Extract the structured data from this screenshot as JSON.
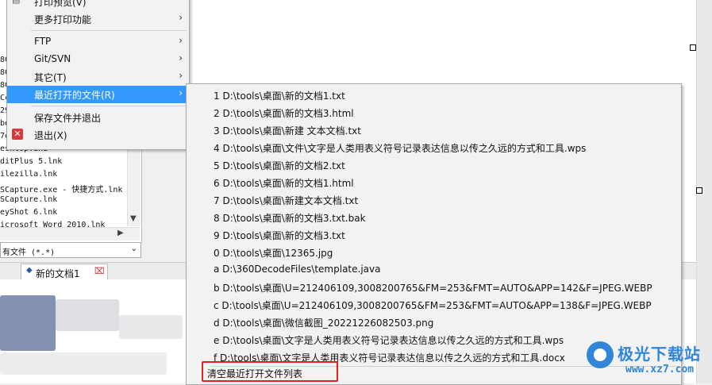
{
  "file_panel": {
    "rows": [
      "8C",
      "8C",
      "8C",
      "Cc",
      "29",
      "be",
      "7e",
      "esktop.ini",
      "ditPlus 5.lnk",
      "ilezilla.lnk",
      "SCapture.exe - 快捷方式.lnk",
      "SCapture.lnk",
      "eyShot 6.lnk",
      "icrosoft Word 2010.lnk"
    ],
    "filter_label": "有文件 (*.*)",
    "filter_dropdown": "⌄"
  },
  "tabs": [
    {
      "label": "新的文档1",
      "icon": "document-icon",
      "close": "⌧"
    }
  ],
  "menu": {
    "items": [
      {
        "label": "打印预览(V)",
        "submenu": false
      },
      {
        "label": "更多打印功能",
        "submenu": true
      },
      {
        "label": "FTP",
        "submenu": true
      },
      {
        "label": "Git/SVN",
        "submenu": true
      },
      {
        "label": "其它(T)",
        "submenu": true
      },
      {
        "label": "最近打开的文件(R)",
        "submenu": true,
        "highlighted": true
      },
      {
        "label": "保存文件并退出",
        "submenu": false
      },
      {
        "label": "退出(X)",
        "submenu": false
      }
    ],
    "submenu_arrow": "›"
  },
  "recent_files": {
    "items": [
      "1 D:\\tools\\桌面\\新的文档1.txt",
      "2 D:\\tools\\桌面\\新的文档3.html",
      "3 D:\\tools\\桌面\\新建 文本文档.txt",
      "4 D:\\tools\\桌面\\文件\\文字是人类用表义符号记录表达信息以传之久远的方式和工具.wps",
      "5 D:\\tools\\桌面\\新的文档2.txt",
      "6 D:\\tools\\桌面\\新的文档1.html",
      "7 D:\\tools\\桌面\\新建文本文档.txt",
      "8 D:\\tools\\桌面\\新的文档3.txt.bak",
      "9 D:\\tools\\桌面\\新的文档3.txt",
      "0 D:\\tools\\桌面\\12365.jpg",
      "a D:\\360DecodeFiles\\template.java",
      "b D:\\tools\\桌面\\U=212406109,3008200765&FM=253&FMT=AUTO&APP=142&F=JPEG.WEBP",
      "c D:\\tools\\桌面\\U=212406109,3008200765&FM=253&FMT=AUTO&APP=138&F=JPEG.WEBP",
      "d D:\\tools\\桌面\\微信截图_20221226082503.png",
      "e D:\\tools\\桌面\\文字是人类用表义符号记录表达信息以传之久远的方式和工具.wps",
      "f D:\\tools\\桌面\\文字是人类用表义符号记录表达信息以传之久远的方式和工具.docx"
    ],
    "clear_label": "清空最近打开文件列表"
  },
  "watermark": {
    "brand": "极光下载站",
    "url": "www.xz7.com"
  },
  "colors": {
    "highlight": "#3399ff",
    "annotation_box": "#e02020",
    "watermark": "#2f86d9"
  }
}
